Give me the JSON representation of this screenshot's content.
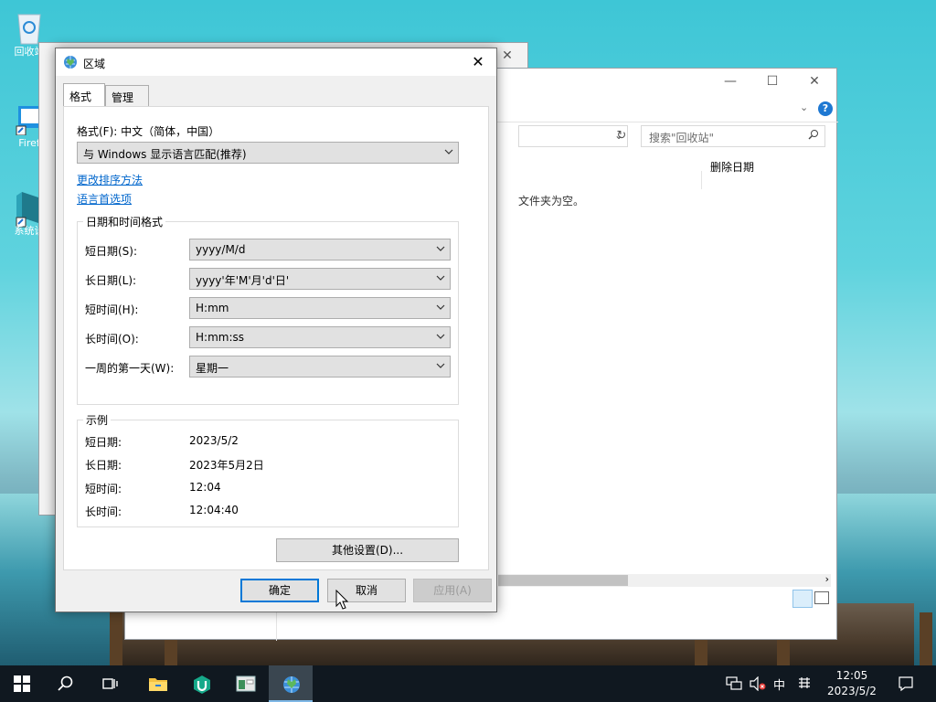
{
  "desktop": {
    "icons": [
      {
        "label": "回收站"
      },
      {
        "label": "Firef"
      },
      {
        "label": "系统设"
      }
    ]
  },
  "background_window": {
    "search_placeholder": "搜索\"回收站\"",
    "column_header": "删除日期",
    "empty_message": "文件夹为空。"
  },
  "dialog": {
    "title": "区域",
    "tabs": [
      {
        "label": "格式"
      },
      {
        "label": "管理"
      }
    ],
    "format_label": "格式(F): 中文（简体，中国）",
    "format_value": "与 Windows 显示语言匹配(推荐)",
    "link_sort": "更改排序方法",
    "link_lang": "语言首选项",
    "datetime_group_title": "日期和时间格式",
    "fields": [
      {
        "label": "短日期(S):",
        "value": "yyyy/M/d"
      },
      {
        "label": "长日期(L):",
        "value": "yyyy'年'M'月'd'日'"
      },
      {
        "label": "短时间(H):",
        "value": "H:mm"
      },
      {
        "label": "长时间(O):",
        "value": "H:mm:ss"
      },
      {
        "label": "一周的第一天(W):",
        "value": "星期一"
      }
    ],
    "example_group_title": "示例",
    "examples": [
      {
        "label": "短日期:",
        "value": "2023/5/2"
      },
      {
        "label": "长日期:",
        "value": "2023年5月2日"
      },
      {
        "label": "短时间:",
        "value": "12:04"
      },
      {
        "label": "长时间:",
        "value": "12:04:40"
      }
    ],
    "other_settings": "其他设置(D)...",
    "ok": "确定",
    "cancel": "取消",
    "apply": "应用(A)"
  },
  "taskbar": {
    "ime": "中",
    "time": "12:05",
    "date": "2023/5/2"
  },
  "colors": {
    "accent": "#0078d7",
    "link": "#0066cc",
    "taskbar": "#101820"
  }
}
